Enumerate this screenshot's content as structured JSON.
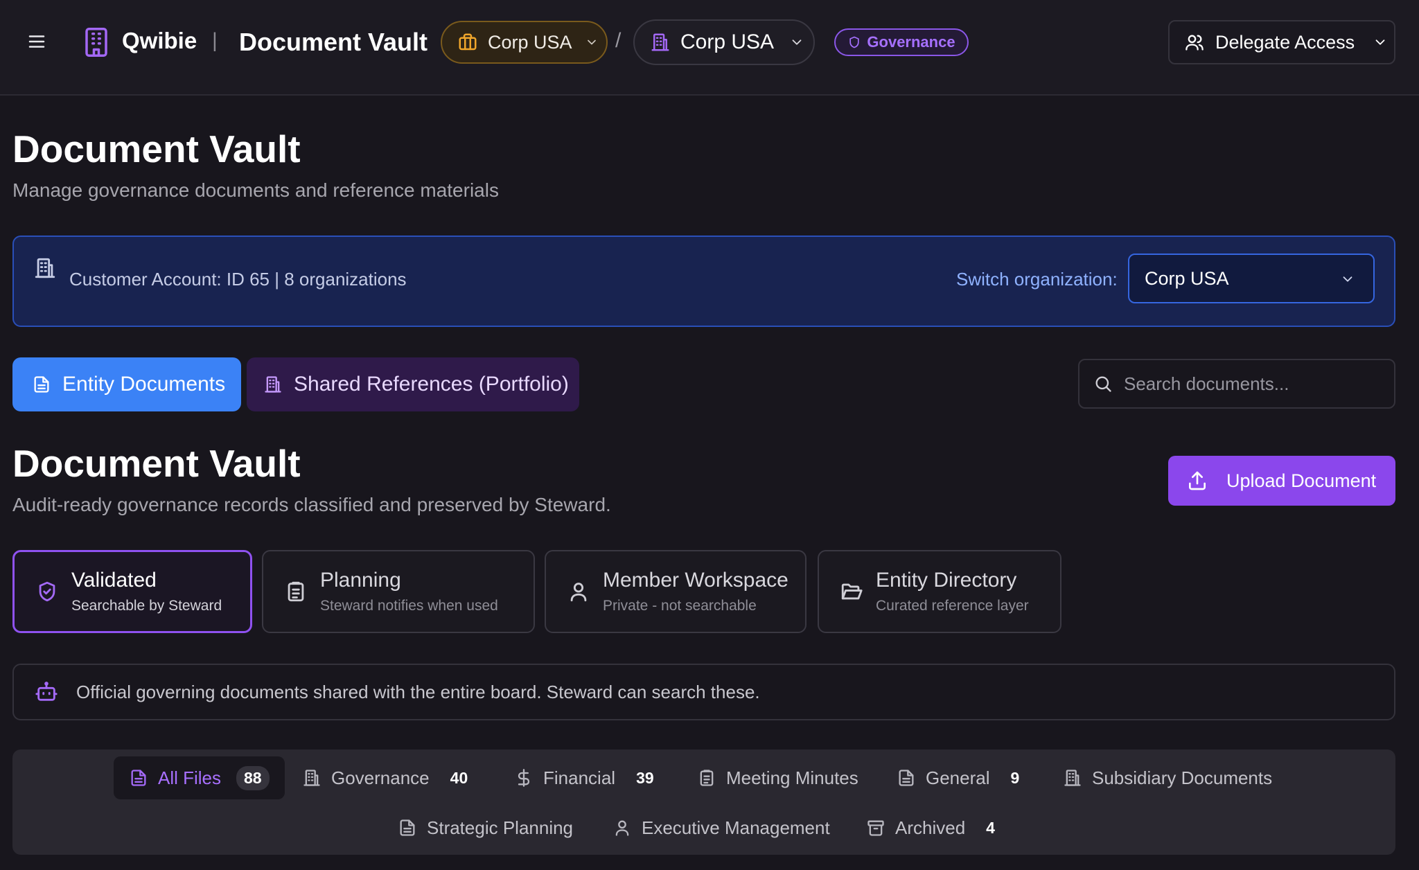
{
  "app": {
    "brand": "Qwibie",
    "separator": "|",
    "page_name": "Document Vault"
  },
  "topbar": {
    "org_chip_1": "Corp USA",
    "crumb_separator": "/",
    "org_chip_2": "Corp USA",
    "badge": "Governance",
    "delegate_label": "Delegate Access"
  },
  "header": {
    "title": "Document Vault",
    "subtitle": "Manage governance documents and reference materials"
  },
  "account_banner": {
    "text": "Customer Account: ID 65 | 8 organizations",
    "switch_label": "Switch organization:",
    "selected_org": "Corp USA"
  },
  "tabs": [
    {
      "label": "Entity Documents",
      "active": true
    },
    {
      "label": "Shared References (Portfolio)",
      "active": false
    }
  ],
  "search": {
    "placeholder": "Search documents...",
    "value": ""
  },
  "vault": {
    "title": "Document Vault",
    "subtitle": "Audit-ready governance records classified and preserved by Steward.",
    "upload_label": "Upload Document"
  },
  "classifications": [
    {
      "title": "Validated",
      "subtitle": "Searchable by Steward",
      "icon": "shield-check-icon",
      "active": true
    },
    {
      "title": "Planning",
      "subtitle": "Steward notifies when used",
      "icon": "clipboard-icon",
      "active": false
    },
    {
      "title": "Member Workspace",
      "subtitle": "Private - not searchable",
      "icon": "user-icon",
      "active": false
    },
    {
      "title": "Entity Directory",
      "subtitle": "Curated reference layer",
      "icon": "folder-open-icon",
      "active": false
    }
  ],
  "info": {
    "text": "Official governing documents shared with the entire board. Steward can search these.",
    "icon": "bot-icon"
  },
  "categories": [
    {
      "label": "All Files",
      "count": "88",
      "icon": "file-icon",
      "active": true
    },
    {
      "label": "Governance",
      "count": "40",
      "icon": "building-icon",
      "active": false
    },
    {
      "label": "Financial",
      "count": "39",
      "icon": "dollar-icon",
      "active": false
    },
    {
      "label": "Meeting Minutes",
      "count": "",
      "icon": "clipboard-icon",
      "active": false
    },
    {
      "label": "General",
      "count": "9",
      "icon": "file-icon",
      "active": false
    },
    {
      "label": "Subsidiary Documents",
      "count": "",
      "icon": "building-icon",
      "active": false
    },
    {
      "label": "Strategic Planning",
      "count": "",
      "icon": "file-icon",
      "active": false
    },
    {
      "label": "Executive Management",
      "count": "",
      "icon": "user-icon",
      "active": false
    },
    {
      "label": "Archived",
      "count": "4",
      "icon": "archive-icon",
      "active": false
    }
  ],
  "colors": {
    "background": "#18161d",
    "accent_purple": "#8b47ec",
    "accent_blue": "#3b82f6",
    "banner_bg": "#182350",
    "warning_orange": "#f0a62b"
  }
}
